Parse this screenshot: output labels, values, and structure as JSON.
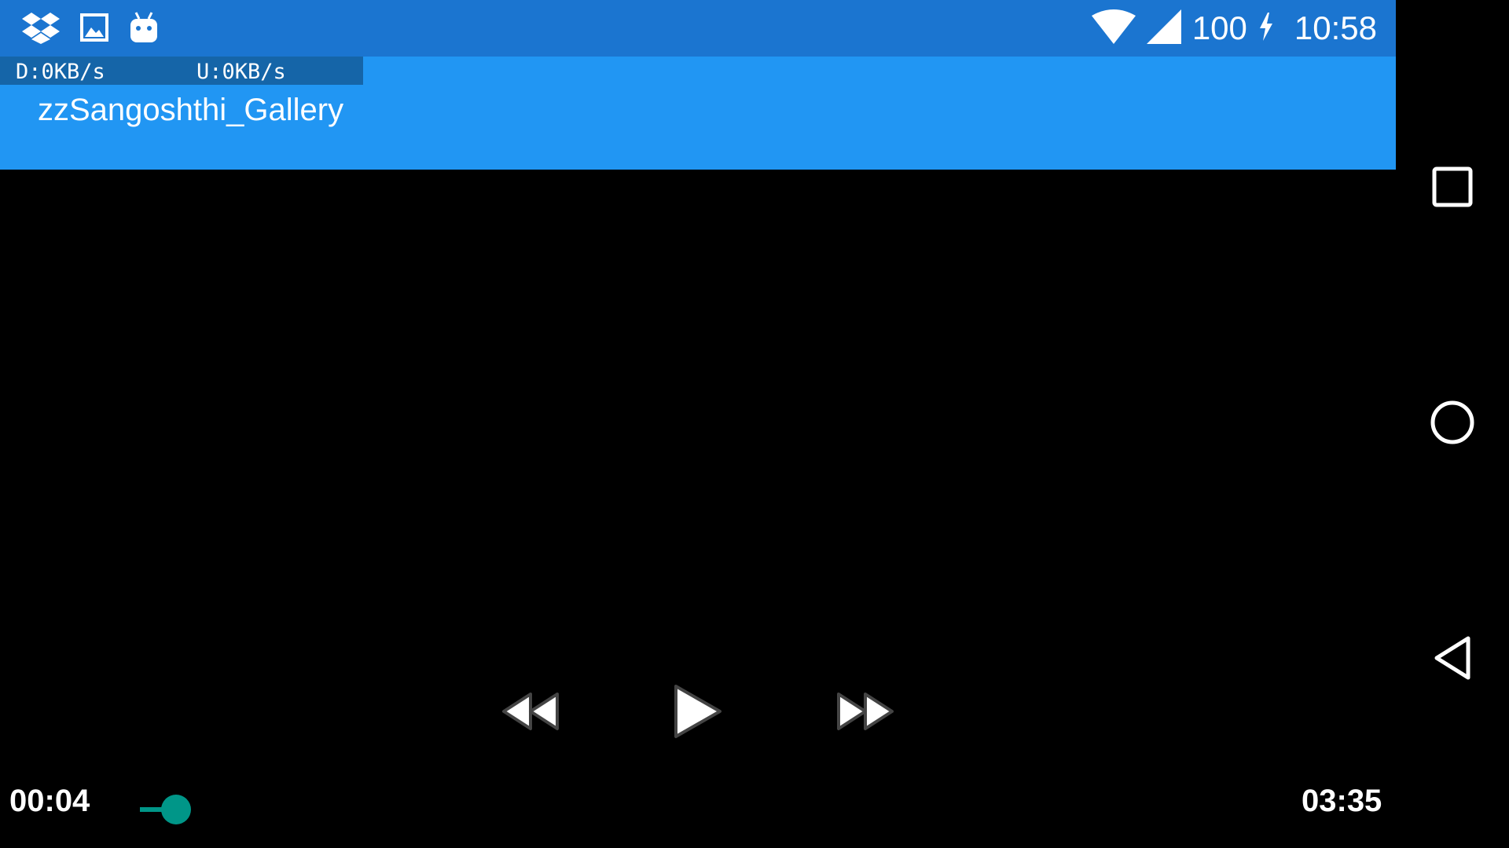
{
  "status_bar": {
    "left_icons": [
      "dropbox-icon",
      "image-icon",
      "android-debug-icon"
    ],
    "battery_level": "100",
    "clock": "10:58",
    "background_color": "#1b75d0"
  },
  "app_bar": {
    "net_download": "D:0KB/s",
    "net_upload": "U:0KB/s",
    "title": "zzSangoshthi_Gallery",
    "background_color": "#2196f3"
  },
  "player": {
    "current_time": "00:04",
    "total_time": "03:35",
    "progress_fraction": 0.019,
    "accent_color": "#009688",
    "controls": [
      "rewind-icon",
      "play-icon",
      "fast-forward-icon"
    ]
  },
  "nav_bar": {
    "buttons": [
      "recents-icon",
      "home-icon",
      "back-icon"
    ]
  }
}
